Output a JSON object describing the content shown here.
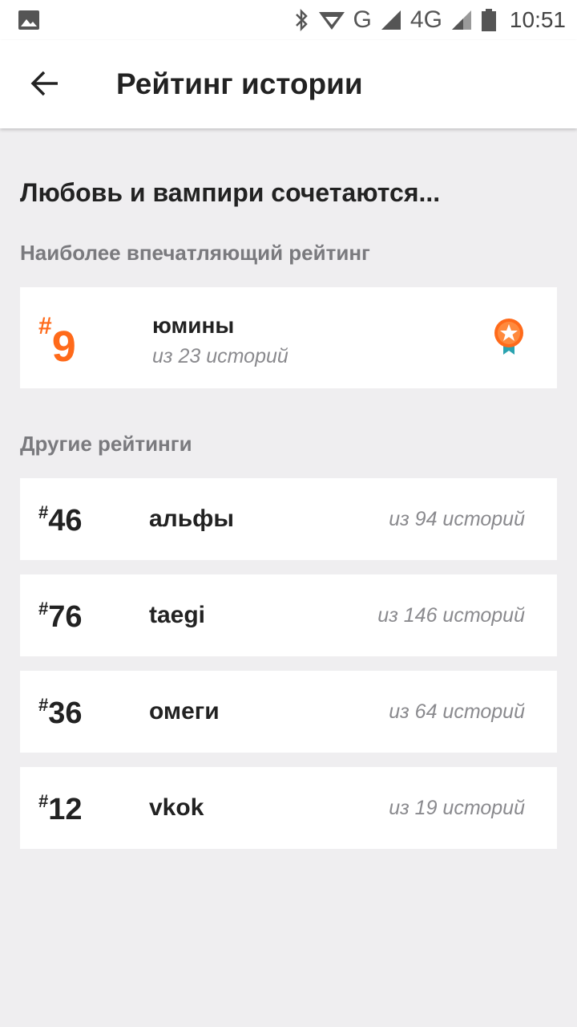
{
  "status_bar": {
    "network_g": "G",
    "network_4g": "4G",
    "time": "10:51"
  },
  "app_bar": {
    "title": "Рейтинг истории",
    "back_icon": "arrow-back-icon"
  },
  "story": {
    "title": "Любовь и вампири сочетаются..."
  },
  "sections": {
    "main_label": "Наиболее впечатляющий рейтинг",
    "other_label": "Другие рейтинги"
  },
  "featured": {
    "hash": "#",
    "rank": "9",
    "tag": "юмины",
    "subtitle": "из 23 историй",
    "icon": "medal-star-icon",
    "accent_color": "#ff6a1a"
  },
  "rankings": [
    {
      "hash": "#",
      "rank": "46",
      "tag": "альфы",
      "count": "из 94 историй"
    },
    {
      "hash": "#",
      "rank": "76",
      "tag": "taegi",
      "count": "из 146 историй"
    },
    {
      "hash": "#",
      "rank": "36",
      "tag": "омеги",
      "count": "из 64 историй"
    },
    {
      "hash": "#",
      "rank": "12",
      "tag": "vkok",
      "count": "из 19 историй"
    }
  ]
}
